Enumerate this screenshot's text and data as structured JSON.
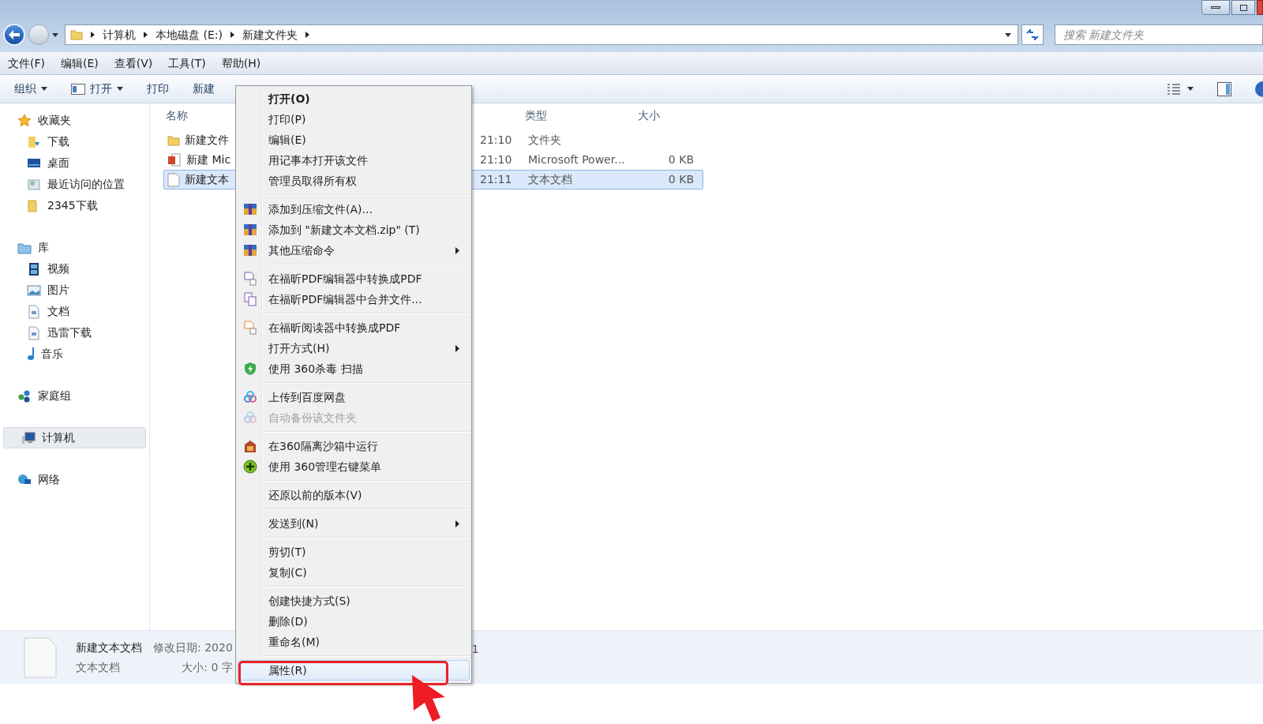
{
  "address_bar": {
    "crumbs": [
      "计算机",
      "本地磁盘 (E:)",
      "新建文件夹"
    ],
    "search_placeholder": "搜索 新建文件夹"
  },
  "menu_bar": [
    "文件(F)",
    "编辑(E)",
    "查看(V)",
    "工具(T)",
    "帮助(H)"
  ],
  "toolbar": [
    {
      "label": "组织",
      "dropdown": true,
      "kind": "plain"
    },
    {
      "label": "打开",
      "dropdown": true,
      "kind": "open"
    },
    {
      "label": "打印",
      "dropdown": false,
      "kind": "plain"
    },
    {
      "label": "新建",
      "dropdown": false,
      "kind": "plain"
    }
  ],
  "sidebar": [
    {
      "label": "收藏夹",
      "kind": "star",
      "selected": false,
      "children": [
        {
          "label": "下载",
          "kind": "download",
          "selected": false
        },
        {
          "label": "桌面",
          "kind": "desktop",
          "selected": false
        },
        {
          "label": "最近访问的位置",
          "kind": "recent",
          "selected": false
        },
        {
          "label": "2345下载",
          "kind": "folder",
          "selected": false
        }
      ]
    },
    {
      "label": "库",
      "kind": "library",
      "selected": false,
      "children": [
        {
          "label": "视频",
          "kind": "video",
          "selected": false
        },
        {
          "label": "图片",
          "kind": "picture",
          "selected": false
        },
        {
          "label": "文档",
          "kind": "doc",
          "selected": false
        },
        {
          "label": "迅雷下载",
          "kind": "doc",
          "selected": false
        },
        {
          "label": "音乐",
          "kind": "music",
          "selected": false
        }
      ]
    },
    {
      "label": "家庭组",
      "kind": "homegroup",
      "selected": false
    },
    {
      "label": "计算机",
      "kind": "computer",
      "selected": true
    },
    {
      "label": "网络",
      "kind": "network",
      "selected": false
    }
  ],
  "table": {
    "columns": [
      "名称",
      "类型",
      "大小"
    ],
    "rows": [
      {
        "name": "新建文件",
        "time": "21:10",
        "type": "文件夹",
        "kind": "folder",
        "selected": false
      },
      {
        "name": "新建 Mic",
        "time": "21:10",
        "type": "Microsoft Power...",
        "size": "0 KB",
        "kind": "ppt",
        "selected": false
      },
      {
        "name": "新建文本",
        "time": "21:11",
        "type": "文本文档",
        "size": "0 KB",
        "kind": "text",
        "selected": true
      }
    ]
  },
  "details": {
    "name": "新建文本文档",
    "type": "文本文档",
    "modified": "修改日期: 2020",
    "size": "大小: 0 字",
    "trailing": "1"
  },
  "context_menu": [
    [
      {
        "label": "打开(O)",
        "kind": "plain",
        "default": true,
        "selected": false,
        "disabled": false,
        "submenu": false
      },
      {
        "label": "打印(P)",
        "kind": "plain",
        "default": false,
        "selected": false,
        "disabled": false,
        "submenu": false
      },
      {
        "label": "编辑(E)",
        "kind": "plain",
        "default": false,
        "selected": false,
        "disabled": false,
        "submenu": false
      },
      {
        "label": "用记事本打开该文件",
        "kind": "plain",
        "default": false,
        "selected": false,
        "disabled": false,
        "submenu": false
      },
      {
        "label": "管理员取得所有权",
        "kind": "plain",
        "default": false,
        "selected": false,
        "disabled": false,
        "submenu": false
      }
    ],
    [
      {
        "label": "添加到压缩文件(A)...",
        "kind": "archive",
        "default": false,
        "selected": false,
        "disabled": false,
        "submenu": false
      },
      {
        "label": "添加到 \"新建文本文档.zip\" (T)",
        "kind": "archive",
        "default": false,
        "selected": false,
        "disabled": false,
        "submenu": false
      },
      {
        "label": "其他压缩命令",
        "kind": "archive",
        "default": false,
        "selected": false,
        "disabled": false,
        "submenu": true
      }
    ],
    [
      {
        "label": "在福昕PDF编辑器中转换成PDF",
        "kind": "pdf",
        "default": false,
        "selected": false,
        "disabled": false,
        "submenu": false
      },
      {
        "label": "在福昕PDF编辑器中合并文件...",
        "kind": "pdfmerge",
        "default": false,
        "selected": false,
        "disabled": false,
        "submenu": false
      }
    ],
    [
      {
        "label": "在福昕阅读器中转换成PDF",
        "kind": "pdfreader",
        "default": false,
        "selected": false,
        "disabled": false,
        "submenu": false
      },
      {
        "label": "打开方式(H)",
        "kind": "plain",
        "default": false,
        "selected": false,
        "disabled": false,
        "submenu": true
      },
      {
        "label": "使用 360杀毒 扫描",
        "kind": "shield",
        "default": false,
        "selected": false,
        "disabled": false,
        "submenu": false
      }
    ],
    [
      {
        "label": "上传到百度网盘",
        "kind": "cloud",
        "default": false,
        "selected": false,
        "disabled": false,
        "submenu": false
      },
      {
        "label": "自动备份该文件夹",
        "kind": "cloud",
        "default": false,
        "selected": false,
        "disabled": true,
        "submenu": false
      }
    ],
    [
      {
        "label": "在360隔离沙箱中运行",
        "kind": "sandbox",
        "default": false,
        "selected": false,
        "disabled": false,
        "submenu": false
      },
      {
        "label": "使用 360管理右键菜单",
        "kind": "plus",
        "default": false,
        "selected": false,
        "disabled": false,
        "submenu": false
      }
    ],
    [
      {
        "label": "还原以前的版本(V)",
        "kind": "plain",
        "default": false,
        "selected": false,
        "disabled": false,
        "submenu": false
      }
    ],
    [
      {
        "label": "发送到(N)",
        "kind": "plain",
        "default": false,
        "selected": false,
        "disabled": false,
        "submenu": true
      }
    ],
    [
      {
        "label": "剪切(T)",
        "kind": "plain",
        "default": false,
        "selected": false,
        "disabled": false,
        "submenu": false
      },
      {
        "label": "复制(C)",
        "kind": "plain",
        "default": false,
        "selected": false,
        "disabled": false,
        "submenu": false
      }
    ],
    [
      {
        "label": "创建快捷方式(S)",
        "kind": "plain",
        "default": false,
        "selected": false,
        "disabled": false,
        "submenu": false
      },
      {
        "label": "删除(D)",
        "kind": "plain",
        "default": false,
        "selected": false,
        "disabled": false,
        "submenu": false
      },
      {
        "label": "重命名(M)",
        "kind": "plain",
        "default": false,
        "selected": false,
        "disabled": false,
        "submenu": false
      }
    ],
    [
      {
        "label": "属性(R)",
        "kind": "plain",
        "default": false,
        "selected": true,
        "disabled": false,
        "submenu": false
      }
    ]
  ]
}
